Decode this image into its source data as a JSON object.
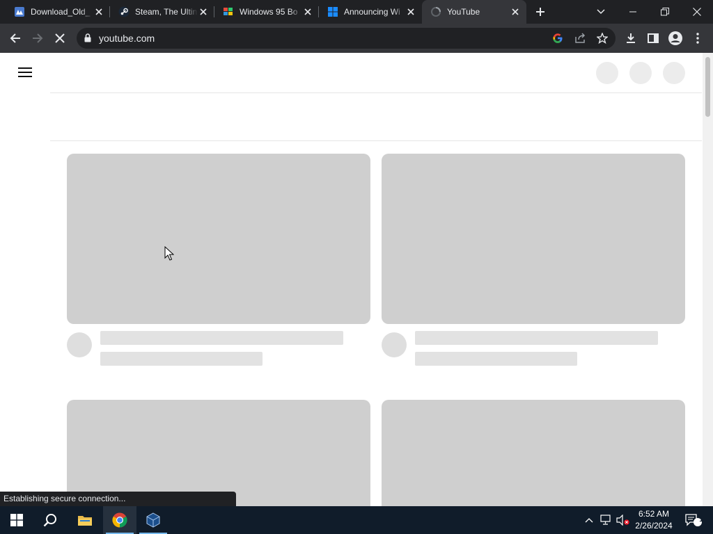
{
  "browser": {
    "tabs": [
      {
        "title": "Download_Old_",
        "icon": "wallpaper-site-icon",
        "active": false
      },
      {
        "title": "Steam, The Ultin",
        "icon": "steam-icon",
        "active": false
      },
      {
        "title": "Windows 95 Bo",
        "icon": "windows95-flag-icon",
        "active": false
      },
      {
        "title": "Announcing Wi",
        "icon": "windows-logo-icon",
        "active": false
      },
      {
        "title": "YouTube",
        "icon": "loading-icon",
        "active": true
      }
    ],
    "address": "youtube.com",
    "status_text": "Establishing secure connection..."
  },
  "taskbar": {
    "apps": [
      "start-icon",
      "search-icon",
      "file-explorer-icon",
      "chrome-icon",
      "virtualbox-icon"
    ],
    "clock_time": "6:52 AM",
    "clock_date": "2/26/2024",
    "notification_count": "1"
  },
  "colors": {
    "tabstrip": "#202124",
    "toolbar": "#35363a",
    "taskbar": "#101c2a",
    "skeleton": "#cfcfcf"
  }
}
